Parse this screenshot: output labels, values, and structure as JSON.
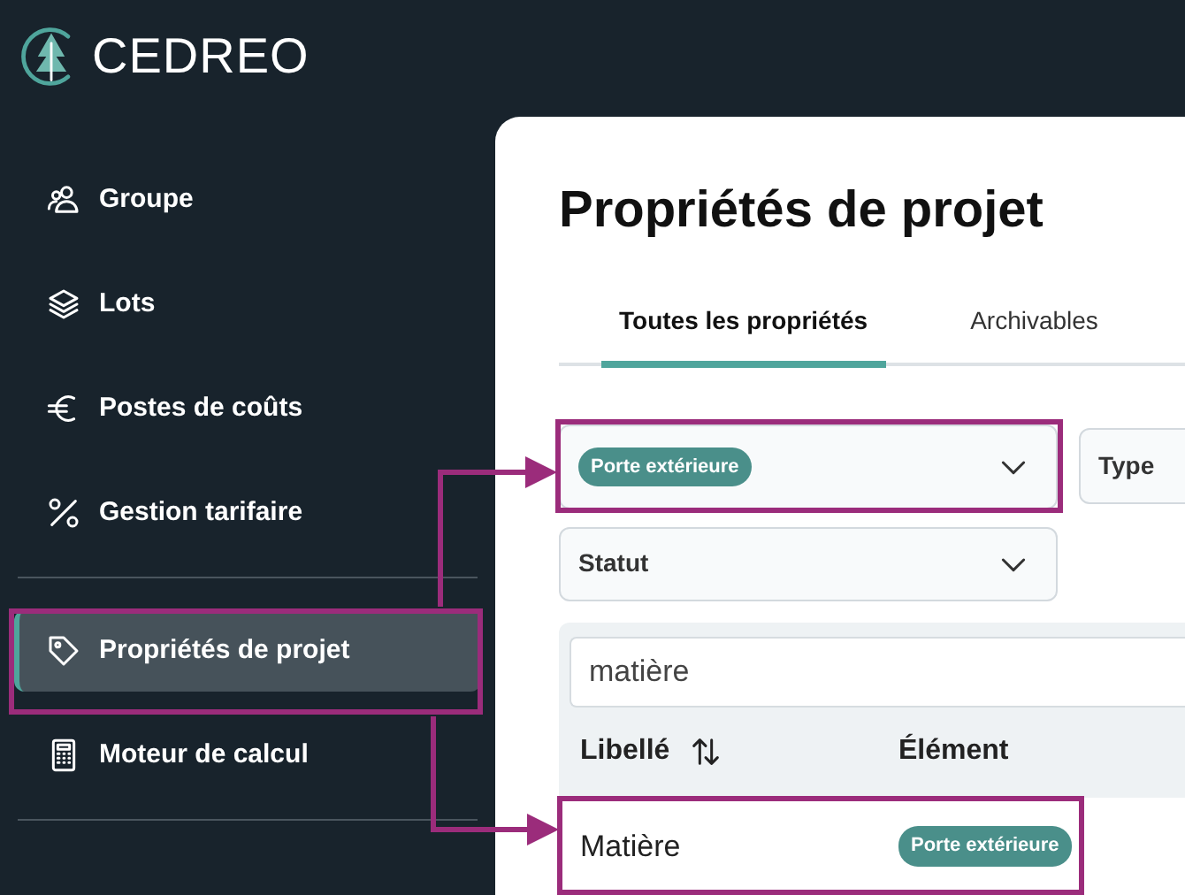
{
  "logo": {
    "text": "CEDREO"
  },
  "sidebar": {
    "sections": [
      {
        "items": [
          {
            "label": "Groupe",
            "selected": false
          },
          {
            "label": "Lots",
            "selected": false
          },
          {
            "label": "Postes de coûts",
            "selected": false
          },
          {
            "label": "Gestion tarifaire",
            "selected": false
          }
        ]
      },
      {
        "items": [
          {
            "label": "Propriétés de projet",
            "selected": true
          },
          {
            "label": "Moteur de calcul",
            "selected": false
          }
        ]
      }
    ]
  },
  "page": {
    "title": "Propriétés de projet",
    "tabs": [
      {
        "label": "Toutes les propriétés",
        "selected": true
      },
      {
        "label": "Archivables",
        "selected": false
      }
    ],
    "filters": [
      {
        "kind": "tag",
        "value": "Porte extérieure"
      },
      {
        "kind": "text",
        "value": "Type"
      },
      {
        "kind": "text",
        "value": "Statut"
      }
    ],
    "table": {
      "search": {
        "value": "matière"
      },
      "columns": [
        {
          "label": "Libellé",
          "sortable": true
        },
        {
          "label": "Élément",
          "sortable": false
        }
      ],
      "rows": [
        {
          "label": "Matière",
          "element": "Porte extérieure"
        }
      ]
    }
  }
}
